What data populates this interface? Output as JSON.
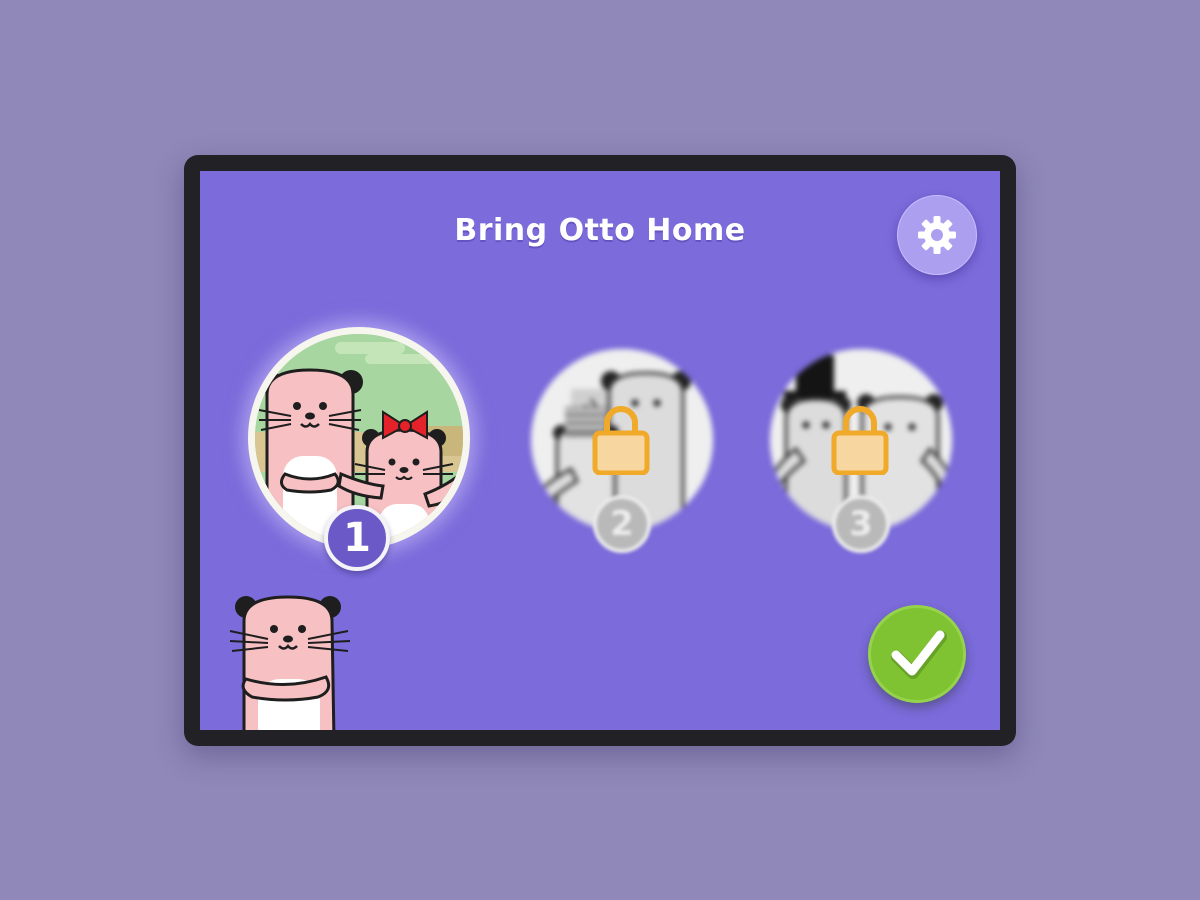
{
  "game": {
    "title": "Bring Otto Home"
  },
  "levels": [
    {
      "number": "1",
      "status": "unlocked",
      "selected": true
    },
    {
      "number": "2",
      "status": "locked"
    },
    {
      "number": "3",
      "status": "locked"
    }
  ],
  "controls": {
    "settings_icon": "gear-icon",
    "confirm_icon": "checkmark-icon"
  },
  "colors": {
    "background": "#8f88b9",
    "screen": "#7b6bdb",
    "confirm": "#7fc232",
    "lock": "#f0a928",
    "otter": "#f7c0c2"
  }
}
